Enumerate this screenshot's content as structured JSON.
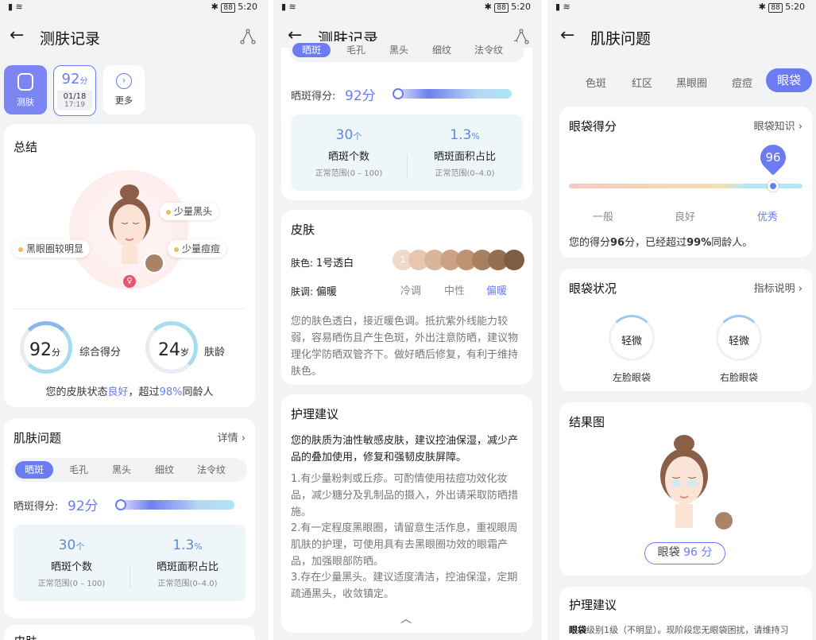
{
  "status": {
    "battery": "88",
    "time": "5:20"
  },
  "p1": {
    "title": "测肤记录",
    "toolbar": {
      "measure_label": "测肤",
      "score": "92",
      "score_unit": "分",
      "date": "01/18",
      "time": "17:19",
      "more_label": "更多"
    },
    "summary": {
      "title": "总结",
      "tags": [
        "少量黑头",
        "黑眼圈较明显",
        "少量痘痘"
      ],
      "score": "92",
      "score_unit": "分",
      "score_label": "综合得分",
      "age": "24",
      "age_unit": "岁",
      "age_label": "肤龄",
      "status_pre": "您的皮肤状态",
      "status_good": "良好",
      "status_mid": "，超过",
      "status_pct": "98%",
      "status_post": "同龄人"
    },
    "issues": {
      "title": "肌肤问题",
      "detail": "详情",
      "tabs": [
        "晒斑",
        "毛孔",
        "黑头",
        "细纹",
        "法令纹"
      ],
      "score_label": "晒斑得分:",
      "score": "92分",
      "count_value": "30",
      "count_unit": "个",
      "count_label": "晒斑个数",
      "count_range": "正常范围(0 – 100)",
      "area_value": "1.3",
      "area_unit": "%",
      "area_label": "晒斑面积占比",
      "area_range": "正常范围(0–4.0)"
    },
    "next_title": "皮肤"
  },
  "p2": {
    "title": "测肤记录",
    "tabs": [
      "晒斑",
      "毛孔",
      "黑头",
      "细纹",
      "法令纹"
    ],
    "score_label": "晒斑得分:",
    "score": "92分",
    "count_value": "30",
    "count_unit": "个",
    "count_label": "晒斑个数",
    "count_range": "正常范围(0 – 100)",
    "area_value": "1.3",
    "area_unit": "%",
    "area_label": "晒斑面积占比",
    "area_range": "正常范围(0–4.0)",
    "skin": {
      "title": "皮肤",
      "color_label": "肤色:",
      "color_value": "1号透白",
      "swatch_selected": "1",
      "swatches": [
        "#f1d9c8",
        "#e7c7ae",
        "#dab59a",
        "#cba384",
        "#bd9373",
        "#a88060",
        "#966f52",
        "#7f5d45"
      ],
      "tone_label": "肤调:",
      "tone_value": "偏暖",
      "tones": [
        "冷调",
        "中性",
        "偏暖"
      ],
      "desc": "您的肤色透白，接近暖色调。抵抗紫外线能力较弱，容易晒伤且产生色斑，外出注意防晒，建议物理化学防晒双管齐下。做好晒后修复，有利于维持肤色。"
    },
    "care": {
      "title": "护理建议",
      "lead": "您的肤质为油性敏感皮肤，建议控油保湿，减少产品的叠加使用，修复和强韧皮肤屏障。",
      "items": [
        "1.有少量粉刺或丘疹。可酌情使用祛痘功效化妆品，减少糖分及乳制品的摄入，外出请采取防晒措施。",
        "2.有一定程度黑眼圈，请留意生活作息，重视眼周肌肤的护理，可使用具有去黑眼圈功效的眼霜产品，加强眼部防晒。",
        "3.存在少量黑头。建议适度清洁，控油保湿，定期疏通黑头，收敛镇定。"
      ]
    }
  },
  "p3": {
    "title": "肌肤问题",
    "tabs": [
      "色斑",
      "红区",
      "黑眼圈",
      "痘痘",
      "眼袋"
    ],
    "score": {
      "title": "眼袋得分",
      "link": "眼袋知识",
      "value": "96",
      "levels": [
        "一般",
        "良好",
        "优秀"
      ],
      "fraction": 0.96,
      "text_pre": "您的得分",
      "text_score": "96",
      "text_mid": "分，已经超过",
      "text_pct": "99%",
      "text_post": "同龄人。"
    },
    "condition": {
      "title": "眼袋状况",
      "link": "指标说明",
      "left_value": "轻微",
      "left_label": "左脸眼袋",
      "right_value": "轻微",
      "right_label": "右脸眼袋"
    },
    "result": {
      "title": "结果图",
      "badge_label": "眼袋",
      "badge_value": "96 分"
    },
    "care": {
      "title": "护理建议",
      "text_bold": "眼袋",
      "text": "级别1级（不明显）。现阶段您无眼袋困扰，请维持习"
    }
  },
  "colors": {
    "accent": "#6a7cf0",
    "blue": "#5b8bd8",
    "gold": "#f4b860",
    "pink": "#e8546f"
  }
}
